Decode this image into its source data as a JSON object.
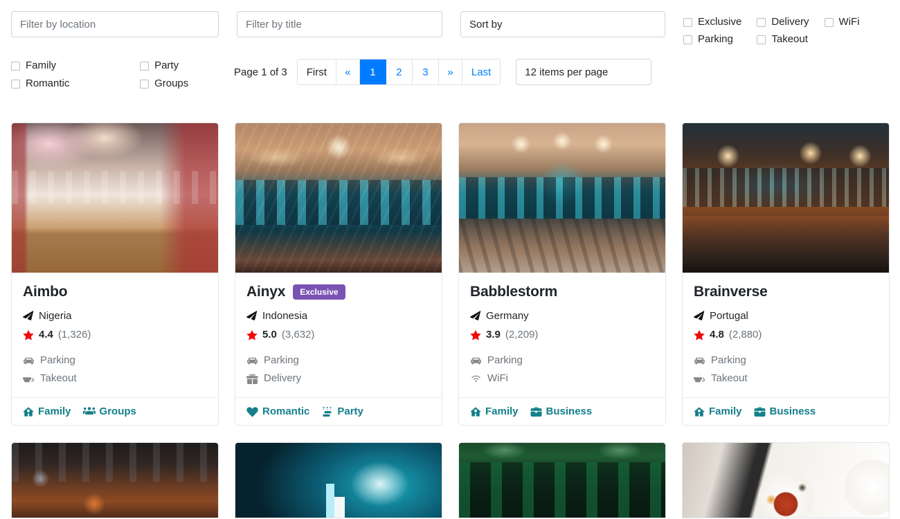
{
  "filters": {
    "location_placeholder": "Filter by location",
    "title_placeholder": "Filter by title",
    "sort_placeholder": "Sort by",
    "feature_checkboxes": [
      {
        "label": "Exclusive",
        "checked": false
      },
      {
        "label": "Delivery",
        "checked": false
      },
      {
        "label": "WiFi",
        "checked": false
      },
      {
        "label": "Parking",
        "checked": false
      },
      {
        "label": "Takeout",
        "checked": false
      }
    ],
    "category_checkboxes": [
      {
        "label": "Family",
        "checked": false
      },
      {
        "label": "Party",
        "checked": false
      },
      {
        "label": "Romantic",
        "checked": false
      },
      {
        "label": "Groups",
        "checked": false
      }
    ]
  },
  "pagination": {
    "page_label": "Page 1 of 3",
    "first": "First",
    "prev": "«",
    "pages": [
      "1",
      "2",
      "3"
    ],
    "active_page": "1",
    "next": "»",
    "last": "Last",
    "per_page": "12 items per page"
  },
  "colors": {
    "accent_blue": "#007bff",
    "badge_purple": "#7952b3",
    "tag_teal": "#147f8b",
    "star_red": "#f00b0b",
    "muted_gray": "#6c757d"
  },
  "cards": [
    {
      "title": "Aimbo",
      "badge": null,
      "location": "Nigeria",
      "rating": "4.4",
      "rating_count": "(1,326)",
      "amenities": [
        {
          "label": "Parking",
          "icon": "car-icon"
        },
        {
          "label": "Takeout",
          "icon": "takeout-cup-icon"
        }
      ],
      "tags": [
        {
          "label": "Family",
          "icon": "home-icon"
        },
        {
          "label": "Groups",
          "icon": "people-icon"
        }
      ]
    },
    {
      "title": "Ainyx",
      "badge": "Exclusive",
      "location": "Indonesia",
      "rating": "5.0",
      "rating_count": "(3,632)",
      "amenities": [
        {
          "label": "Parking",
          "icon": "car-icon"
        },
        {
          "label": "Delivery",
          "icon": "gift-icon"
        }
      ],
      "tags": [
        {
          "label": "Romantic",
          "icon": "heart-icon"
        },
        {
          "label": "Party",
          "icon": "cake-icon"
        }
      ]
    },
    {
      "title": "Babblestorm",
      "badge": null,
      "location": "Germany",
      "rating": "3.9",
      "rating_count": "(2,209)",
      "amenities": [
        {
          "label": "Parking",
          "icon": "car-icon"
        },
        {
          "label": "WiFi",
          "icon": "wifi-icon"
        }
      ],
      "tags": [
        {
          "label": "Family",
          "icon": "home-icon"
        },
        {
          "label": "Business",
          "icon": "briefcase-icon"
        }
      ]
    },
    {
      "title": "Brainverse",
      "badge": null,
      "location": "Portugal",
      "rating": "4.8",
      "rating_count": "(2,880)",
      "amenities": [
        {
          "label": "Parking",
          "icon": "car-icon"
        },
        {
          "label": "Takeout",
          "icon": "takeout-cup-icon"
        }
      ],
      "tags": [
        {
          "label": "Family",
          "icon": "home-icon"
        },
        {
          "label": "Business",
          "icon": "briefcase-icon"
        }
      ]
    }
  ]
}
